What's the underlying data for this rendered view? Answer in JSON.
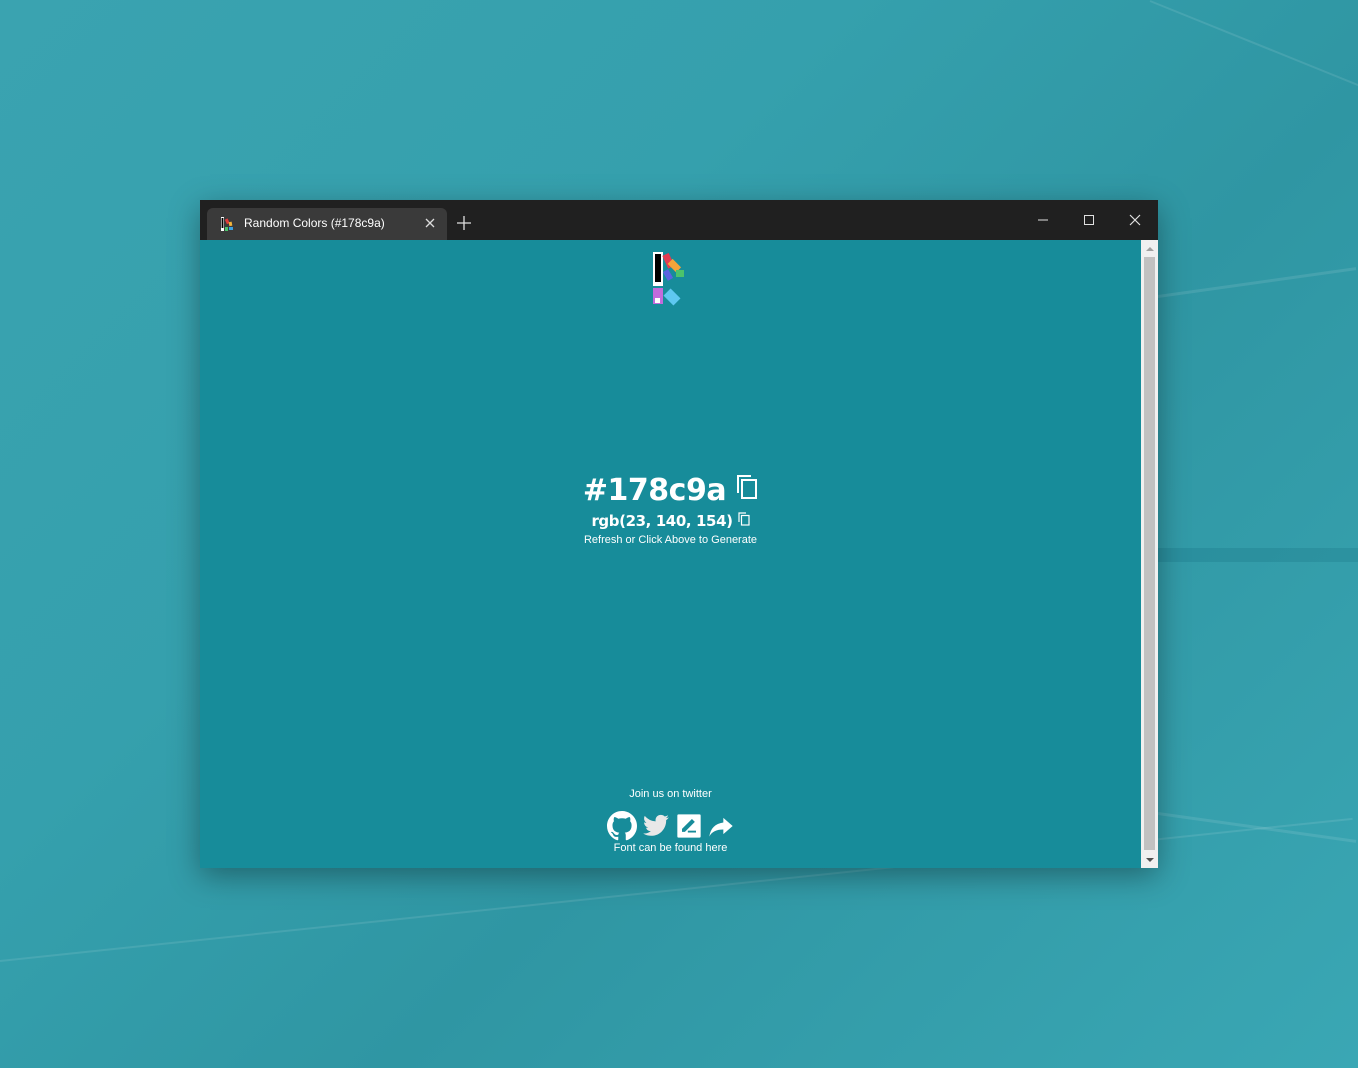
{
  "browser": {
    "tab_title": "Random Colors (#178c9a)",
    "tab_close_icon": "close-icon",
    "new_tab_icon": "plus-icon",
    "window_controls": [
      "minimize-icon",
      "maximize-icon",
      "close-icon"
    ]
  },
  "page": {
    "background_color": "#178c9a",
    "hex_value": "#178c9a",
    "rgb_value": "rgb(23, 140, 154)",
    "hint": "Refresh or Click Above to Generate",
    "footer_twitter": "Join us on twitter",
    "social_icons": [
      "github-icon",
      "twitter-icon",
      "edit-icon",
      "share-icon"
    ],
    "font_link": "Font can be found here"
  },
  "colors": {
    "titlebar": "#202020",
    "active_tab": "#3a3a3a",
    "desktop": "#35a0ad"
  }
}
